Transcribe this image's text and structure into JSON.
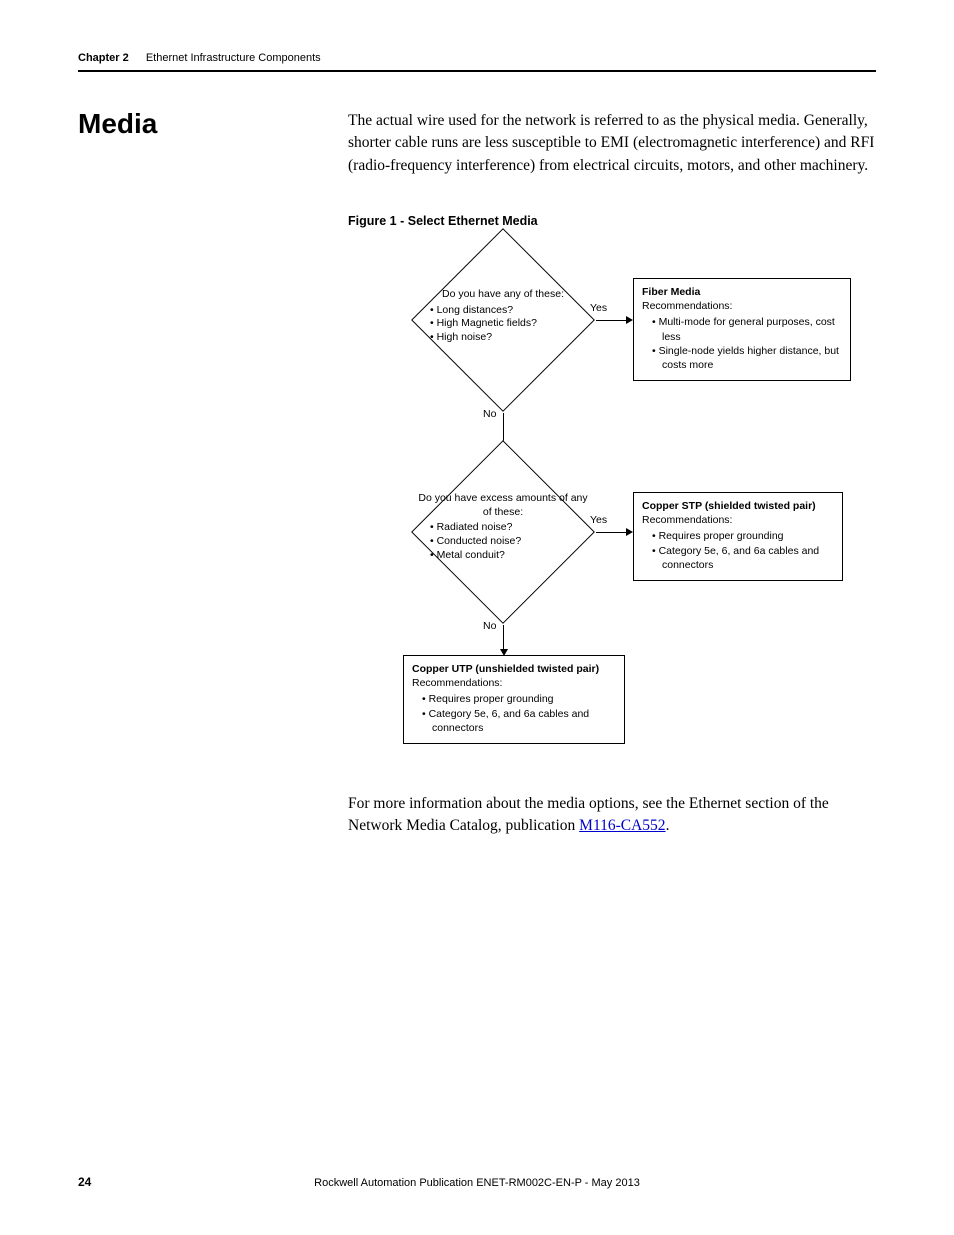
{
  "header": {
    "chapter": "Chapter 2",
    "title": "Ethernet Infrastructure Components"
  },
  "section": {
    "heading": "Media",
    "intro": "The actual wire used for the network is referred to as the physical media. Generally, shorter cable runs are less susceptible to EMI (electromagnetic interference) and RFI (radio-frequency interference) from electrical circuits, motors, and other machinery."
  },
  "figure": {
    "caption": "Figure 1 - Select Ethernet Media",
    "labels": {
      "yes": "Yes",
      "no": "No"
    },
    "decision1": {
      "question": "Do you have any of these:",
      "items": [
        "Long distances?",
        "High Magnetic fields?",
        "High noise?"
      ]
    },
    "decision2": {
      "question": "Do you have excess amounts of any of these:",
      "items": [
        "Radiated noise?",
        "Conducted noise?",
        "Metal conduit?"
      ]
    },
    "result1": {
      "title": "Fiber Media",
      "rec_label": "Recommendations:",
      "items": [
        "Multi-mode for general purposes, cost less",
        "Single-node yields higher distance, but costs more"
      ]
    },
    "result2": {
      "title": "Copper STP (shielded twisted pair)",
      "rec_label": "Recommendations:",
      "items": [
        "Requires proper grounding",
        "Category 5e, 6, and 6a cables and connectors"
      ]
    },
    "result3": {
      "title": "Copper UTP (unshielded twisted pair)",
      "rec_label": "Recommendations:",
      "items": [
        "Requires proper grounding",
        "Category 5e, 6, and 6a cables and connectors"
      ]
    }
  },
  "closing": {
    "text_before": "For more information about the media options, see the Ethernet section of the Network Media Catalog, publication ",
    "link_text": "M116-CA552",
    "text_after": "."
  },
  "footer": {
    "page": "24",
    "pub": "Rockwell Automation Publication ENET-RM002C-EN-P - May 2013"
  }
}
